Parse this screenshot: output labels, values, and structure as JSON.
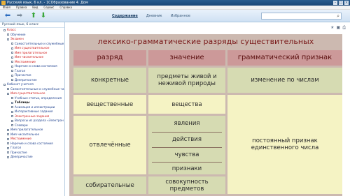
{
  "window": {
    "title": "Русский язык, 6 кл. - 1СОбразование 4. Дом"
  },
  "menu": [
    "Файл",
    "Правка",
    "Вид",
    "Сервис",
    "Справка"
  ],
  "nav_tabs": [
    {
      "label": "Содержание",
      "active": true
    },
    {
      "label": "Дневник",
      "active": false
    },
    {
      "label": "Избранное",
      "active": false
    }
  ],
  "search": {
    "placeholder": ""
  },
  "sidebar": {
    "title": "Русский язык, 6 класс",
    "items": [
      {
        "label": "Класс",
        "level": 0,
        "style": "red"
      },
      {
        "label": "Обучение",
        "level": 1,
        "style": "blue"
      },
      {
        "label": "Экзамен",
        "level": 1,
        "style": "red"
      },
      {
        "label": "Самостоятельные и служебные",
        "level": 2,
        "style": "blue"
      },
      {
        "label": "Имя существительное",
        "level": 2,
        "style": "red"
      },
      {
        "label": "Имя прилагательное",
        "level": 2,
        "style": "red"
      },
      {
        "label": "Имя числительное",
        "level": 2,
        "style": "red"
      },
      {
        "label": "Местоимение",
        "level": 2,
        "style": "red"
      },
      {
        "label": "Наречие и слова состояния",
        "level": 2,
        "style": "blue"
      },
      {
        "label": "Глагол",
        "level": 2,
        "style": "blue"
      },
      {
        "label": "Причастие",
        "level": 2,
        "style": "blue"
      },
      {
        "label": "Деепричастие",
        "level": 2,
        "style": "blue"
      },
      {
        "label": "Кабинет учителя",
        "level": 0,
        "style": "blue"
      },
      {
        "label": "Самостоятельные и служебные ча",
        "level": 1,
        "style": "blue"
      },
      {
        "label": "Имя существительное",
        "level": 1,
        "style": "red"
      },
      {
        "label": "Учебные статьи, определения",
        "level": 2,
        "style": "blue"
      },
      {
        "label": "Таблицы",
        "level": 2,
        "style": "bold"
      },
      {
        "label": "Анимация и иллюстрации",
        "level": 2,
        "style": "blue"
      },
      {
        "label": "Интерактивные задания",
        "level": 2,
        "style": "blue"
      },
      {
        "label": "Электронные задания",
        "level": 2,
        "style": "red"
      },
      {
        "label": "Вопросы из раздела «Электрон",
        "level": 2,
        "style": "blue"
      },
      {
        "label": "Словари",
        "level": 2,
        "style": "blue"
      },
      {
        "label": "Имя прилагательное",
        "level": 1,
        "style": "blue"
      },
      {
        "label": "Имя числительное",
        "level": 1,
        "style": "blue"
      },
      {
        "label": "Местоимение",
        "level": 1,
        "style": "red"
      },
      {
        "label": "Наречие и слова состояния",
        "level": 1,
        "style": "blue"
      },
      {
        "label": "Глагол",
        "level": 1,
        "style": "blue"
      },
      {
        "label": "Причастие",
        "level": 1,
        "style": "blue"
      },
      {
        "label": "Деепричастие",
        "level": 1,
        "style": "blue"
      }
    ]
  },
  "slide": {
    "title": "лексико-грамматические разряды существительных",
    "headers": [
      "разряд",
      "значение",
      "грамматический признак"
    ],
    "rows": {
      "concrete": {
        "category": "конкретные",
        "meaning": "предметы живой и неживой природы",
        "feature": "изменение по числам"
      },
      "material": {
        "category": "вещественные",
        "meaning": "вещества"
      },
      "abstract": {
        "category": "отвлечённые",
        "meanings": [
          "явления",
          "действия",
          "чувства",
          "признаки"
        ]
      },
      "collective": {
        "category": "собирательные",
        "meaning": "совокупность предметов"
      },
      "shared_feature": "постоянный признак единственного числа"
    }
  },
  "colors": {
    "header_bg": "#cc9999",
    "green_cell": "#d6dbb2",
    "yellow_cell": "#f5f3c4",
    "slide_bg": "#ccb9b0",
    "title_text": "#7a1a1a"
  }
}
